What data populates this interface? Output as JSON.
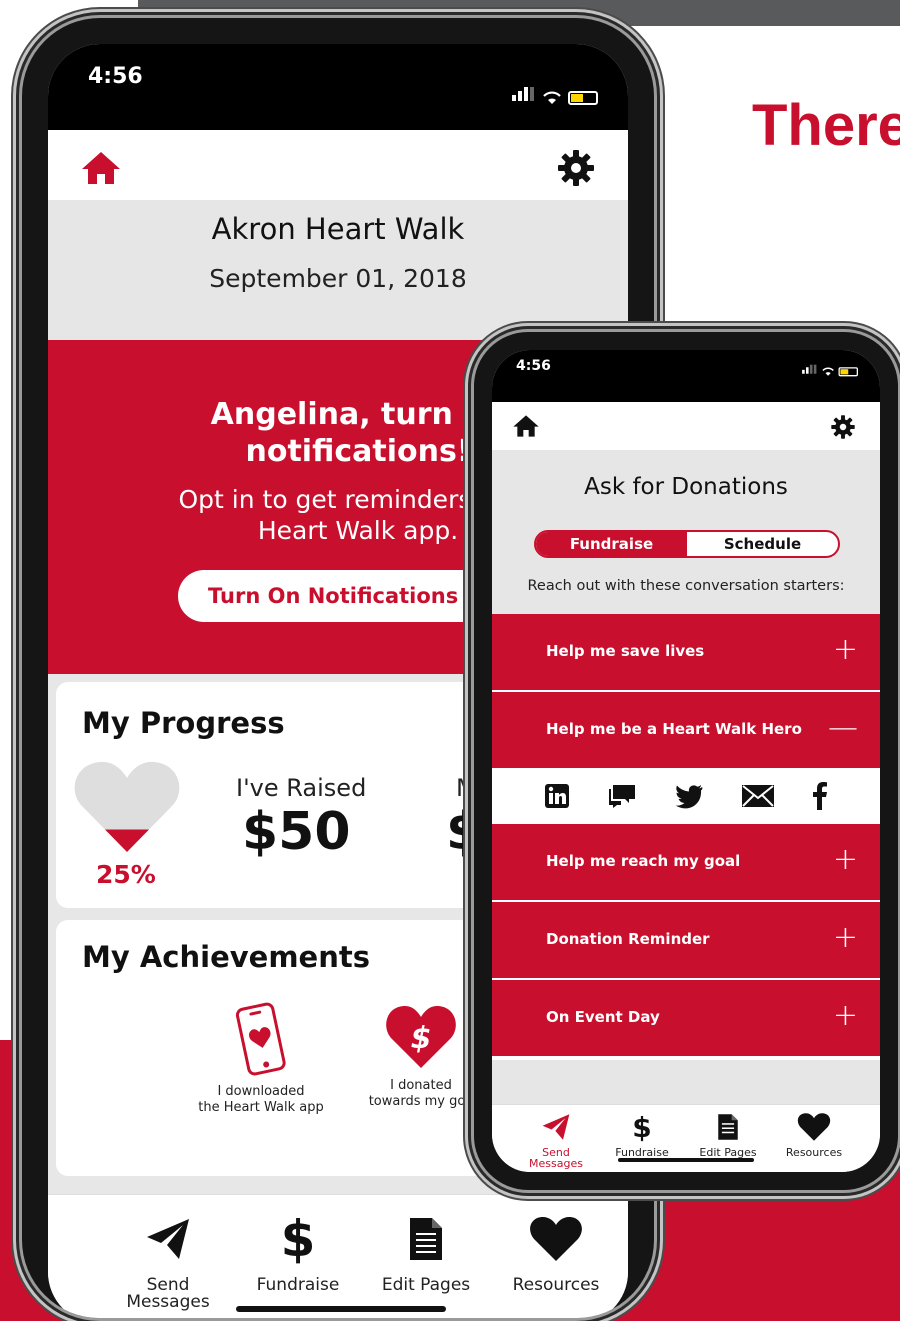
{
  "headline": "There",
  "big_phone": {
    "status_time": "4:56",
    "event": {
      "title": "Akron Heart Walk",
      "date": "September 01, 2018"
    },
    "notification": {
      "title_line1": "Angelina, turn on",
      "title_line2": "notifications!",
      "text_line1": "Opt in to get reminders from",
      "text_line2": "Heart Walk app.",
      "button": "Turn On Notifications"
    },
    "progress": {
      "title": "My Progress",
      "percent_label": "25%",
      "percent": 25,
      "raised_label": "I've Raised",
      "raised_value": "$50",
      "goal_label": "M",
      "goal_value": "$"
    },
    "achievements": {
      "title": "My Achievements",
      "items": [
        {
          "label": "I downloaded\nthe Heart Walk app"
        },
        {
          "label": "I donated\ntowards my goa"
        }
      ]
    },
    "nav": [
      {
        "label": "Send\nMessages"
      },
      {
        "label": "Fundraise",
        "glyph": "$"
      },
      {
        "label": "Edit Pages"
      },
      {
        "label": "Resources"
      }
    ]
  },
  "small_phone": {
    "status_time": "4:56",
    "title": "Ask for Donations",
    "segments": [
      "Fundraise",
      "Schedule"
    ],
    "intro": "Reach out with these conversation starters:",
    "accordion": [
      {
        "label": "Help me save lives",
        "sign": "+"
      },
      {
        "label": "Help me be a Heart Walk Hero",
        "sign": "—"
      },
      {
        "label": "Help me reach my goal",
        "sign": "+"
      },
      {
        "label": "Donation Reminder",
        "sign": "+"
      },
      {
        "label": "On Event Day",
        "sign": "+"
      }
    ],
    "share_icons": [
      "linkedin-icon",
      "chat-icon",
      "twitter-icon",
      "email-icon",
      "facebook-icon"
    ],
    "nav": [
      {
        "label": "Send\nMessages"
      },
      {
        "label": "Fundraise",
        "glyph": "$"
      },
      {
        "label": "Edit Pages"
      },
      {
        "label": "Resources"
      }
    ]
  },
  "colors": {
    "brand_red": "#c8102e",
    "panel_gray": "#e6e6e6",
    "frame": "#151515"
  }
}
